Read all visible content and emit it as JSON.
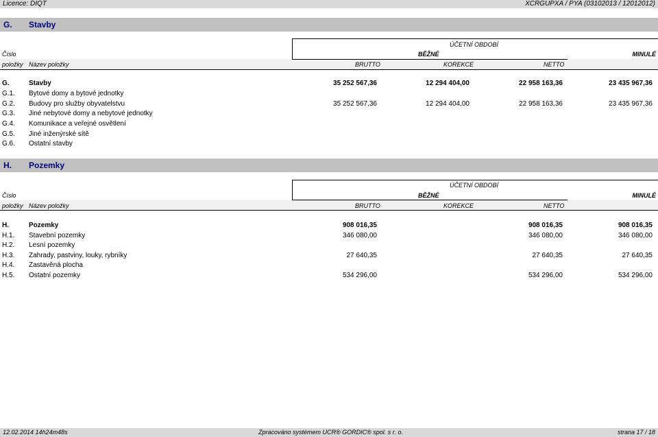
{
  "header": {
    "licence": "Licence: DIQT",
    "doc_id": "XCRGUPXA / PYA  (03102013 / 12012012)"
  },
  "sections": [
    {
      "code": "G.",
      "title": "Stavby",
      "columns": {
        "cislo": "Číslo",
        "polozky": "položky",
        "nazev": "Název položky",
        "ucetni": "ÚČETNÍ OBDOBÍ",
        "bezne": "BĚŽNÉ",
        "minule": "MINULÉ",
        "brutto": "BRUTTO",
        "korekce": "KOREKCE",
        "netto": "NETTO"
      },
      "rows": [
        {
          "code": "G.",
          "name": "Stavby",
          "brutto": "35 252 567,36",
          "korekce": "12 294 404,00",
          "netto": "22 958 163,36",
          "minule": "23 435 967,36",
          "bold": true
        },
        {
          "code": "G.1.",
          "name": "Bytové domy a bytové jednotky",
          "brutto": "",
          "korekce": "",
          "netto": "",
          "minule": ""
        },
        {
          "code": "G.2.",
          "name": "Budovy pro služby obyvatelstvu",
          "brutto": "35 252 567,36",
          "korekce": "12 294 404,00",
          "netto": "22 958 163,36",
          "minule": "23 435 967,36"
        },
        {
          "code": "G.3.",
          "name": "Jiné nebytové domy a nebytové jednotky",
          "brutto": "",
          "korekce": "",
          "netto": "",
          "minule": ""
        },
        {
          "code": "G.4.",
          "name": "Komunikace a veřejné osvětlení",
          "brutto": "",
          "korekce": "",
          "netto": "",
          "minule": ""
        },
        {
          "code": "G.5.",
          "name": "Jiné inženýrské sítě",
          "brutto": "",
          "korekce": "",
          "netto": "",
          "minule": ""
        },
        {
          "code": "G.6.",
          "name": "Ostatní stavby",
          "brutto": "",
          "korekce": "",
          "netto": "",
          "minule": ""
        }
      ]
    },
    {
      "code": "H.",
      "title": "Pozemky",
      "columns": {
        "cislo": "Číslo",
        "polozky": "položky",
        "nazev": "Název položky",
        "ucetni": "ÚČETNÍ OBDOBÍ",
        "bezne": "BĚŽNÉ",
        "minule": "MINULÉ",
        "brutto": "BRUTTO",
        "korekce": "KOREKCE",
        "netto": "NETTO"
      },
      "rows": [
        {
          "code": "H.",
          "name": "Pozemky",
          "brutto": "908 016,35",
          "korekce": "",
          "netto": "908 016,35",
          "minule": "908 016,35",
          "bold": true
        },
        {
          "code": "H.1.",
          "name": "Stavební pozemky",
          "brutto": "346 080,00",
          "korekce": "",
          "netto": "346 080,00",
          "minule": "346 080,00"
        },
        {
          "code": "H.2.",
          "name": "Lesní pozemky",
          "brutto": "",
          "korekce": "",
          "netto": "",
          "minule": ""
        },
        {
          "code": "H.3.",
          "name": "Zahrady, pastviny, louky, rybníky",
          "brutto": "27 640,35",
          "korekce": "",
          "netto": "27 640,35",
          "minule": "27 640,35"
        },
        {
          "code": "H.4.",
          "name": "Zastavěná plocha",
          "brutto": "",
          "korekce": "",
          "netto": "",
          "minule": ""
        },
        {
          "code": "H.5.",
          "name": "Ostatní pozemky",
          "brutto": "534 296,00",
          "korekce": "",
          "netto": "534 296,00",
          "minule": "534 296,00"
        }
      ]
    }
  ],
  "footer": {
    "timestamp": "12.02.2014 14h24m48s",
    "processed": "Zpracováno systémem UCR® GORDIC® spol. s  r. o.",
    "page": "strana 17 / 18"
  }
}
